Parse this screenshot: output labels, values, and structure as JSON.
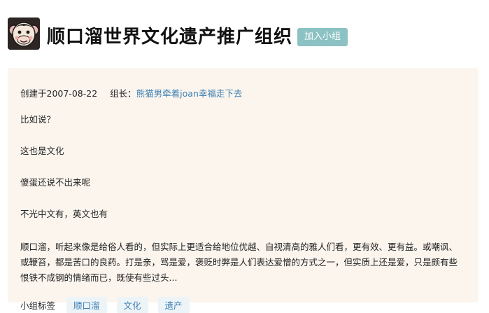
{
  "group": {
    "title": "顺口溜世界文化遗产推广组织",
    "join_label": "加入小组",
    "created_label": "创建于2007-08-22",
    "leader_prefix": "组长：",
    "leader_name": "熊猫男牵着joan幸福走下去"
  },
  "intro": {
    "paragraphs": [
      "比如说？",
      "这也是文化",
      "傻蛋还说不出来呢",
      "不光中文有，英文也有"
    ],
    "long_text": "顺口溜，听起来像是给俗人看的，但实际上更适合给地位优越、自视清高的雅人们看，更有效、更有益。或嘲讽、或鞭笞，都是苦口的良药。打是亲，骂是爱，褒贬时弊是人们表达爱憎的方式之一，但实质上还是爱，只是颇有些恨铁不成钢的情绪而已，既使有些过头..."
  },
  "tags": {
    "label": "小组标签",
    "items": [
      "顺口溜",
      "文化",
      "遗产"
    ]
  },
  "colors": {
    "join_button": "#8cc2c3",
    "card_background": "#fbf5ee",
    "link": "#3c7fb3",
    "tag_background": "#edf4f8"
  }
}
